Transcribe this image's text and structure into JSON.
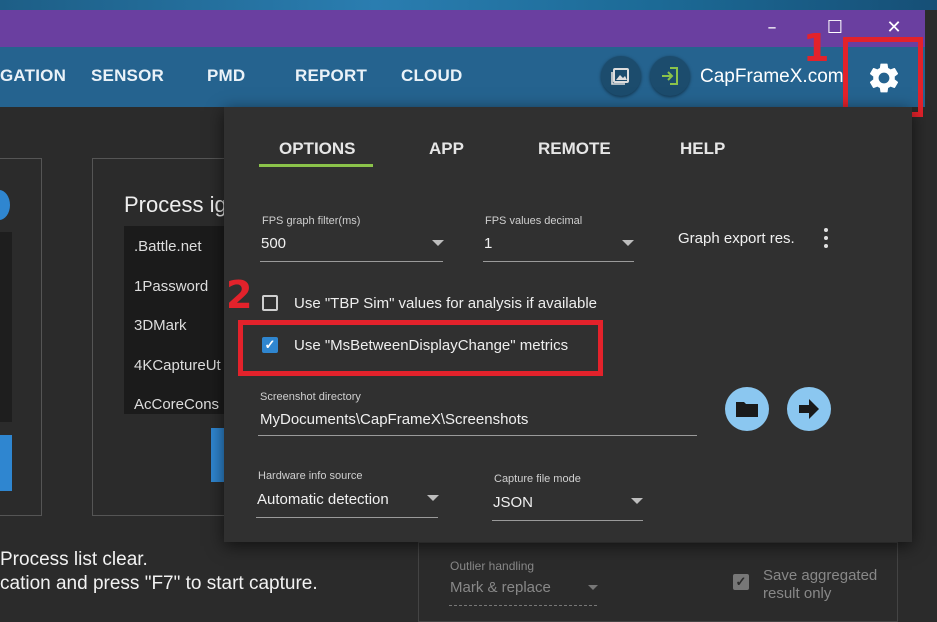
{
  "window": {
    "minimize_glyph": "–",
    "maximize_glyph": "☐",
    "close_glyph": "✕"
  },
  "nav": {
    "items": [
      "GATION",
      "SENSOR",
      "PMD",
      "REPORT",
      "CLOUD"
    ],
    "brand": "CapFrameX.com",
    "annotation_1": "1",
    "icons": [
      "screenshot-icon",
      "login-icon",
      "gear-icon"
    ]
  },
  "background": {
    "process_title": "Process ig",
    "process_items": [
      ".Battle.net",
      "1Password",
      "3DMark",
      "4KCaptureUt",
      "AcCoreCons"
    ],
    "status_line1": "Process list clear.",
    "status_line2": "cation and press \"F7\" to start capture.",
    "outlier_label": "Outlier handling",
    "outlier_value": "Mark & replace",
    "save_aggregated": "Save aggregated result only"
  },
  "popup": {
    "tabs": [
      "OPTIONS",
      "APP",
      "REMOTE",
      "HELP"
    ],
    "active_tab": "OPTIONS",
    "fps_filter_label": "FPS graph filter(ms)",
    "fps_filter_value": "500",
    "fps_decimal_label": "FPS values decimal",
    "fps_decimal_value": "1",
    "graph_export_label": "Graph export res.",
    "annotation_2": "2",
    "tbp_label": "Use \"TBP Sim\" values for analysis if available",
    "tbp_checked": false,
    "msbdc_label": "Use \"MsBetweenDisplayChange\" metrics",
    "msbdc_checked": true,
    "screenshot_dir_label": "Screenshot directory",
    "screenshot_dir_value": "MyDocuments\\CapFrameX\\Screenshots",
    "hw_source_label": "Hardware info source",
    "hw_source_value": "Automatic detection",
    "capture_mode_label": "Capture file mode",
    "capture_mode_value": "JSON"
  },
  "colors": {
    "accent_green": "#8bc34a",
    "highlight_red": "#e3222b",
    "checkbox_blue": "#2f86d0"
  }
}
